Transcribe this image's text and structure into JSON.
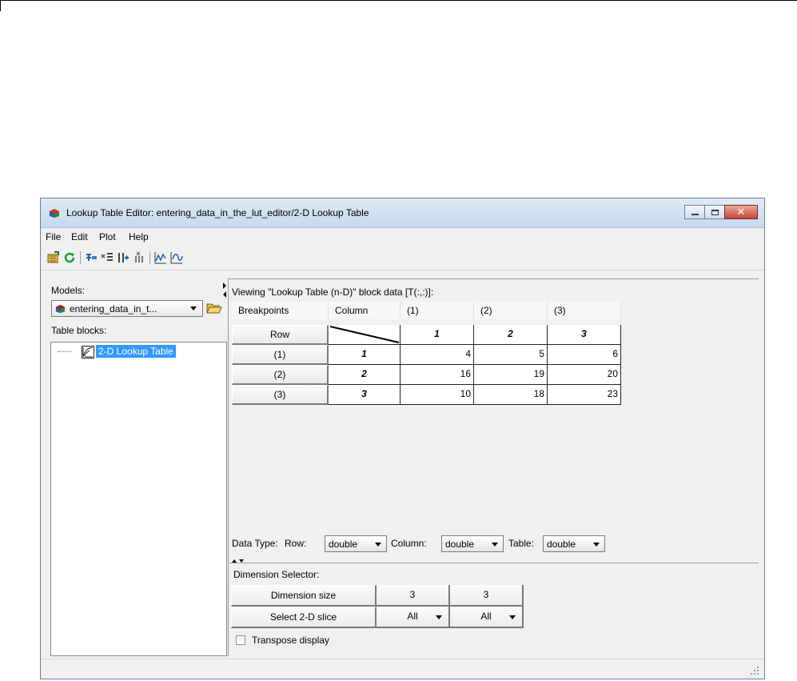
{
  "window": {
    "title": "Lookup Table Editor: entering_data_in_the_lut_editor/2-D Lookup Table",
    "close_glyph": "✕"
  },
  "menu": [
    "File",
    "Edit",
    "Plot",
    "Help"
  ],
  "toolbar_icons": [
    "open-block-icon",
    "refresh-icon",
    "add-row-icon",
    "remove-row-icon",
    "add-column-icon",
    "remove-column-icon",
    "line-plot-icon",
    "mesh-plot-icon"
  ],
  "left": {
    "models_label": "Models:",
    "model_value": "entering_data_in_t...",
    "table_blocks_label": "Table blocks:",
    "tree_item": "2-D Lookup Table"
  },
  "view": {
    "label": "Viewing \"Lookup Table (n-D)\" block data [T(:,:)]:",
    "header": [
      "Breakpoints",
      "Column",
      "(1)",
      "(2)",
      "(3)"
    ],
    "row_header": "Row",
    "column_breakpoints": [
      "1",
      "2",
      "3"
    ],
    "row_labels": [
      "(1)",
      "(2)",
      "(3)"
    ],
    "row_breakpoints": [
      "1",
      "2",
      "3"
    ],
    "table": [
      [
        "4",
        "5",
        "6"
      ],
      [
        "16",
        "19",
        "20"
      ],
      [
        "10",
        "18",
        "23"
      ]
    ]
  },
  "data_type": {
    "label": "Data Type:",
    "row_label": "Row:",
    "row_value": "double",
    "column_label": "Column:",
    "column_value": "double",
    "table_label": "Table:",
    "table_value": "double"
  },
  "dimension": {
    "label": "Dimension Selector:",
    "size_label": "Dimension size",
    "sizes": [
      "3",
      "3"
    ],
    "slice_label": "Select 2-D slice",
    "slices": [
      "All",
      "All"
    ],
    "transpose_label": "Transpose display"
  }
}
